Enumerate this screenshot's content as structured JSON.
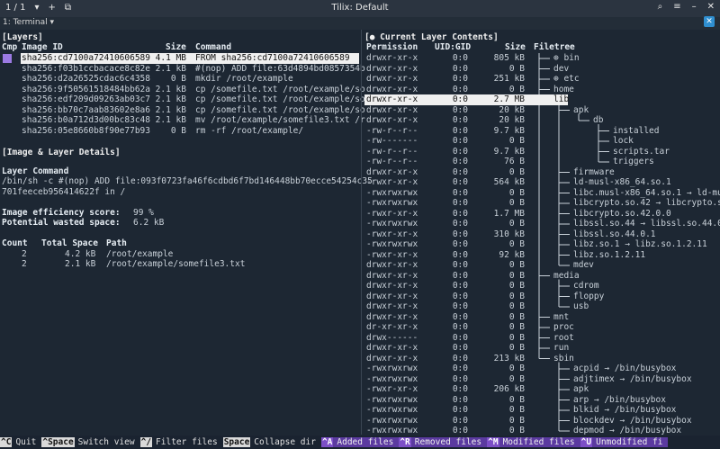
{
  "window": {
    "tab_counter": "1 / 1",
    "title": "Tilix: Default"
  },
  "tab": {
    "label": "1: Terminal"
  },
  "layers": {
    "title": "[Layers]",
    "headers": [
      "Cmp",
      "Image ID",
      "Size",
      "Command"
    ],
    "rows": [
      {
        "id": "sha256:cd7100a72410606589",
        "size": "4.1 MB",
        "cmd": "FROM sha256:cd7100a72410606589"
      },
      {
        "id": "sha256:f03b1ccbacace8c82e",
        "size": "2.1 kB",
        "cmd": "#(nop) ADD file:63d4894bd0857354b"
      },
      {
        "id": "sha256:d2a26525cdac6c4358",
        "size": "0 B",
        "cmd": "mkdir /root/example"
      },
      {
        "id": "sha256:9f50561518484bb62a",
        "size": "2.1 kB",
        "cmd": "cp /somefile.txt /root/example/so"
      },
      {
        "id": "sha256:edf209d09263ab03c7",
        "size": "2.1 kB",
        "cmd": "cp /somefile.txt /root/example/so"
      },
      {
        "id": "sha256:bb70c7aab83602e8a6",
        "size": "2.1 kB",
        "cmd": "cp /somefile.txt /root/example/so"
      },
      {
        "id": "sha256:b0a712d3d00bc83c48",
        "size": "2.1 kB",
        "cmd": "mv /root/example/somefile3.txt /r"
      },
      {
        "id": "sha256:05e8660b8f90e77b93",
        "size": "0 B",
        "cmd": "rm -rf /root/example/"
      }
    ]
  },
  "details": {
    "title": "[Image & Layer Details]",
    "layer_command_label": "Layer Command",
    "layer_command_1": "/bin/sh -c #(nop) ADD file:093f0723fa46f6cdbd6f7bd146448bb70ecce54254c35",
    "layer_command_2": "701feeceb956414622f in /",
    "efficiency_label": "Image efficiency score:",
    "efficiency_value": "99 %",
    "wasted_label": "Potential wasted space:",
    "wasted_value": "6.2 kB",
    "waste_headers": [
      "Count",
      "Total Space",
      "Path"
    ],
    "waste_rows": [
      {
        "count": "2",
        "space": "4.2 kB",
        "path": "/root/example"
      },
      {
        "count": "2",
        "space": "2.1 kB",
        "path": "/root/example/somefile3.txt"
      }
    ]
  },
  "contents": {
    "title": "[● Current Layer Contents]",
    "headers": [
      "Permission",
      "UID:GID",
      "Size",
      "Filetree"
    ],
    "rows": [
      {
        "perm": "drwxr-xr-x",
        "uid": "0:0",
        "size": "805 kB",
        "name": "⊕ bin"
      },
      {
        "perm": "drwxr-xr-x",
        "uid": "0:0",
        "size": "0 B",
        "name": "dev"
      },
      {
        "perm": "drwxr-xr-x",
        "uid": "0:0",
        "size": "251 kB",
        "name": "⊕ etc"
      },
      {
        "perm": "drwxr-xr-x",
        "uid": "0:0",
        "size": "0 B",
        "name": "home"
      },
      {
        "perm": "drwxr-xr-x",
        "uid": "0:0",
        "size": "2.7 MB",
        "name": "lib"
      },
      {
        "perm": "drwxr-xr-x",
        "uid": "0:0",
        "size": "20 kB",
        "name": "apk"
      },
      {
        "perm": "drwxr-xr-x",
        "uid": "0:0",
        "size": "20 kB",
        "name": "db"
      },
      {
        "perm": "-rw-r--r--",
        "uid": "0:0",
        "size": "9.7 kB",
        "name": "installed"
      },
      {
        "perm": "-rw-------",
        "uid": "0:0",
        "size": "0 B",
        "name": "lock"
      },
      {
        "perm": "-rw-r--r--",
        "uid": "0:0",
        "size": "9.7 kB",
        "name": "scripts.tar"
      },
      {
        "perm": "-rw-r--r--",
        "uid": "0:0",
        "size": "76 B",
        "name": "triggers"
      },
      {
        "perm": "drwxr-xr-x",
        "uid": "0:0",
        "size": "0 B",
        "name": "firmware"
      },
      {
        "perm": "-rwxr-xr-x",
        "uid": "0:0",
        "size": "564 kB",
        "name": "ld-musl-x86_64.so.1"
      },
      {
        "perm": "-rwxrwxrwx",
        "uid": "0:0",
        "size": "0 B",
        "name": "libc.musl-x86_64.so.1 → ld-mu"
      },
      {
        "perm": "-rwxrwxrwx",
        "uid": "0:0",
        "size": "0 B",
        "name": "libcrypto.so.42 → libcrypto.s"
      },
      {
        "perm": "-rwxr-xr-x",
        "uid": "0:0",
        "size": "1.7 MB",
        "name": "libcrypto.so.42.0.0"
      },
      {
        "perm": "-rwxrwxrwx",
        "uid": "0:0",
        "size": "0 B",
        "name": "libssl.so.44 → libssl.so.44.0"
      },
      {
        "perm": "-rwxr-xr-x",
        "uid": "0:0",
        "size": "310 kB",
        "name": "libssl.so.44.0.1"
      },
      {
        "perm": "-rwxrwxrwx",
        "uid": "0:0",
        "size": "0 B",
        "name": "libz.so.1 → libz.so.1.2.11"
      },
      {
        "perm": "-rwxr-xr-x",
        "uid": "0:0",
        "size": "92 kB",
        "name": "libz.so.1.2.11"
      },
      {
        "perm": "drwxr-xr-x",
        "uid": "0:0",
        "size": "0 B",
        "name": "mdev"
      },
      {
        "perm": "drwxr-xr-x",
        "uid": "0:0",
        "size": "0 B",
        "name": "media"
      },
      {
        "perm": "drwxr-xr-x",
        "uid": "0:0",
        "size": "0 B",
        "name": "cdrom"
      },
      {
        "perm": "drwxr-xr-x",
        "uid": "0:0",
        "size": "0 B",
        "name": "floppy"
      },
      {
        "perm": "drwxr-xr-x",
        "uid": "0:0",
        "size": "0 B",
        "name": "usb"
      },
      {
        "perm": "drwxr-xr-x",
        "uid": "0:0",
        "size": "0 B",
        "name": "mnt"
      },
      {
        "perm": "dr-xr-xr-x",
        "uid": "0:0",
        "size": "0 B",
        "name": "proc"
      },
      {
        "perm": "drwx------",
        "uid": "0:0",
        "size": "0 B",
        "name": "root"
      },
      {
        "perm": "drwxr-xr-x",
        "uid": "0:0",
        "size": "0 B",
        "name": "run"
      },
      {
        "perm": "drwxr-xr-x",
        "uid": "0:0",
        "size": "213 kB",
        "name": "sbin"
      },
      {
        "perm": "-rwxrwxrwx",
        "uid": "0:0",
        "size": "0 B",
        "name": "acpid → /bin/busybox"
      },
      {
        "perm": "-rwxrwxrwx",
        "uid": "0:0",
        "size": "0 B",
        "name": "adjtimex → /bin/busybox"
      },
      {
        "perm": "-rwxr-xr-x",
        "uid": "0:0",
        "size": "206 kB",
        "name": "apk"
      },
      {
        "perm": "-rwxrwxrwx",
        "uid": "0:0",
        "size": "0 B",
        "name": "arp → /bin/busybox"
      },
      {
        "perm": "-rwxrwxrwx",
        "uid": "0:0",
        "size": "0 B",
        "name": "blkid → /bin/busybox"
      },
      {
        "perm": "-rwxrwxrwx",
        "uid": "0:0",
        "size": "0 B",
        "name": "blockdev → /bin/busybox"
      },
      {
        "perm": "-rwxrwxrwx",
        "uid": "0:0",
        "size": "0 B",
        "name": "depmod → /bin/busybox"
      }
    ]
  },
  "status": {
    "items": [
      {
        "key": "^C",
        "desc": "Quit"
      },
      {
        "key": "^Space",
        "desc": "Switch view"
      },
      {
        "key": "^/",
        "desc": "Filter files"
      },
      {
        "key": "Space",
        "desc": "Collapse dir"
      }
    ],
    "purple_items": [
      {
        "key": "^A",
        "desc": "Added files"
      },
      {
        "key": "^R",
        "desc": "Removed files"
      },
      {
        "key": "^M",
        "desc": "Modified files"
      },
      {
        "key": "^U",
        "desc": "Unmodified fi"
      }
    ]
  },
  "colors": {
    "accent": "#2f8fd1",
    "cmp_purple": "#9b7ae2",
    "highlight": "#f0f0f0",
    "background": "#1d2733"
  }
}
